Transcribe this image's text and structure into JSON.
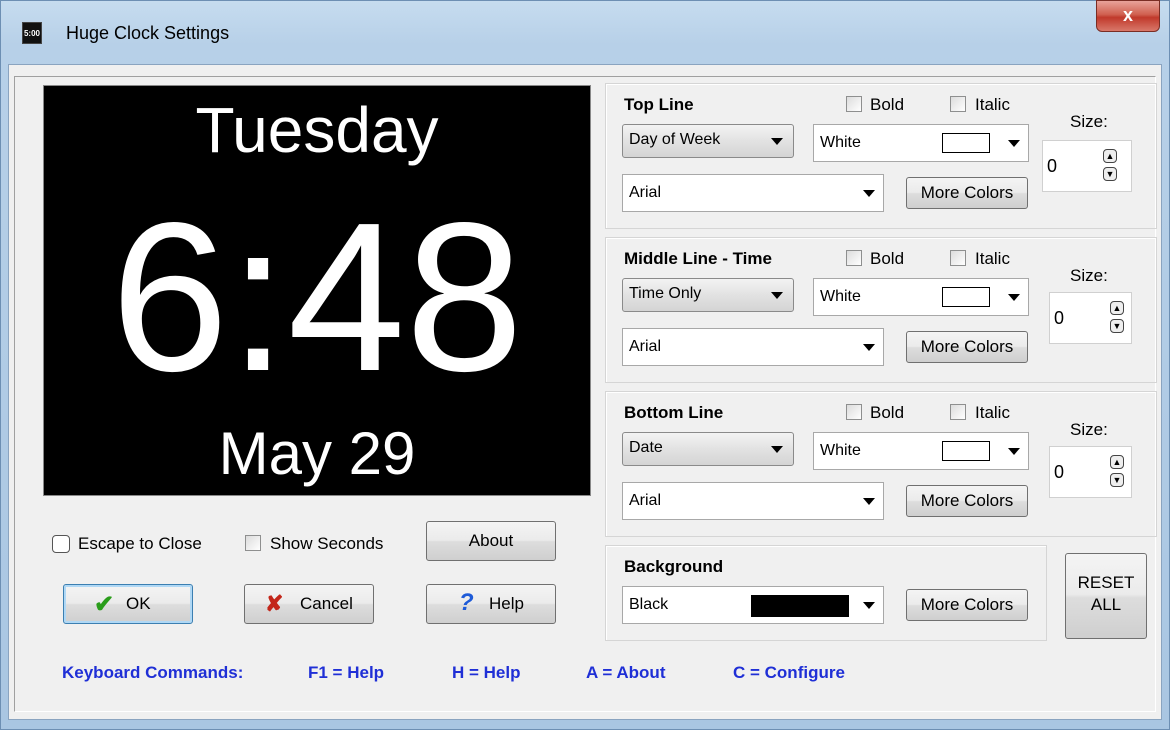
{
  "window": {
    "title": "Huge Clock Settings",
    "icon_text": "5:00",
    "close_label": "x"
  },
  "preview": {
    "top_line": "Tuesday",
    "middle_line": "6:48",
    "bottom_line": "May 29"
  },
  "options": {
    "escape_to_close": "Escape to Close",
    "show_seconds": "Show Seconds",
    "about": "About"
  },
  "buttons": {
    "ok": "OK",
    "cancel": "Cancel",
    "help": "Help",
    "reset_line1": "RESET",
    "reset_line2": "ALL"
  },
  "top_line": {
    "title": "Top Line",
    "bold": "Bold",
    "italic": "Italic",
    "size_label": "Size:",
    "size_value": "0",
    "content": "Day of Week",
    "color": "White",
    "font": "Arial",
    "more_colors": "More Colors"
  },
  "middle_line": {
    "title": "Middle Line - Time",
    "bold": "Bold",
    "italic": "Italic",
    "size_label": "Size:",
    "size_value": "0",
    "content": "Time Only",
    "color": "White",
    "font": "Arial",
    "more_colors": "More Colors"
  },
  "bottom_line": {
    "title": "Bottom Line",
    "bold": "Bold",
    "italic": "Italic",
    "size_label": "Size:",
    "size_value": "0",
    "content": "Date",
    "color": "White",
    "font": "Arial",
    "more_colors": "More Colors"
  },
  "background": {
    "title": "Background",
    "color": "Black",
    "more_colors": "More Colors"
  },
  "keyboard": {
    "label": "Keyboard Commands:",
    "f1": "F1 = Help",
    "h": "H = Help",
    "a": "A = About",
    "c": "C = Configure"
  },
  "colors": {
    "keyboard_text": "#1f2fd6",
    "preview_bg": "#000000",
    "preview_text": "#ffffff"
  }
}
